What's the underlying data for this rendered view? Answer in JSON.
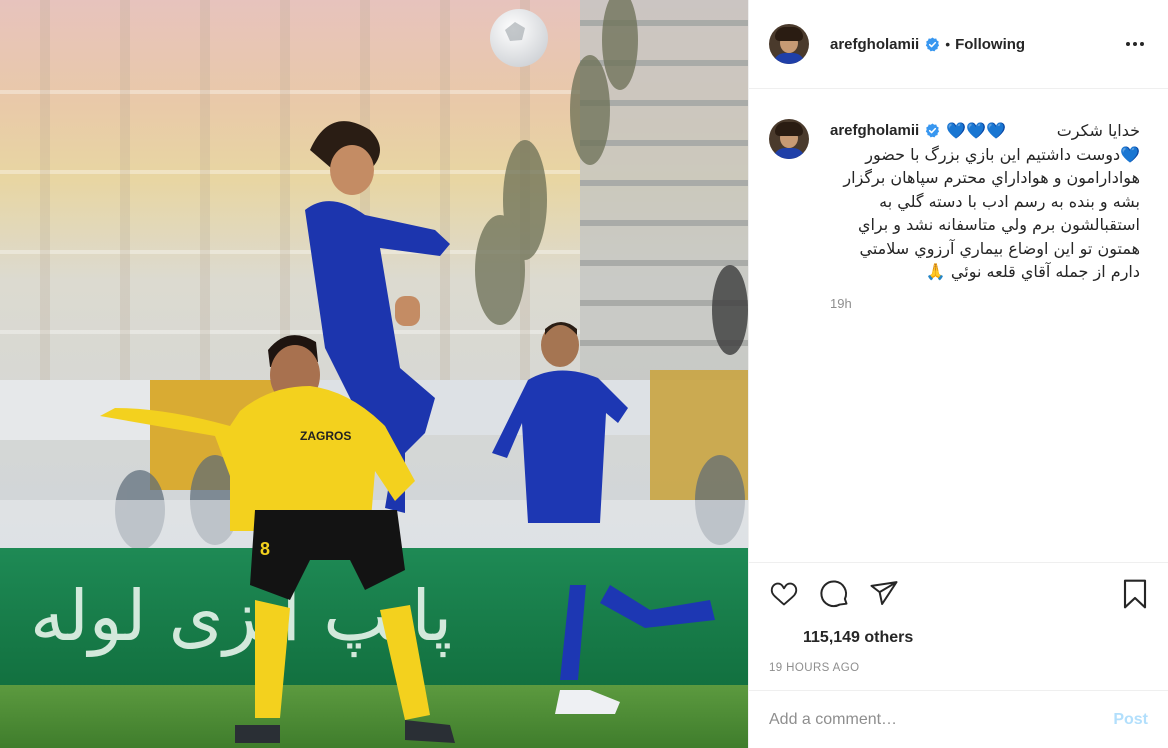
{
  "header": {
    "username": "arefgholamii",
    "separator": "•",
    "follow_status": "Following"
  },
  "caption": {
    "username": "arefgholamii",
    "first_line": "خدايا شكرت",
    "hearts": "💙💙💙",
    "body": "💙دوست داشتيم اين بازي بزرگ با حضور هوادارامون و هواداراي محترم سپاهان برگزار بشه و بنده به رسم ادب با دسته گلي به استقبالشون برم ولي متاسفانه نشد و براي همتون تو اين اوضاع بيماري آرزوي سلامتي دارم از جمله آقاي قلعه نوئي 🙏",
    "time": "19h"
  },
  "likes": {
    "text": "115,149 others"
  },
  "timestamp": "19 HOURS AGO",
  "comment_box": {
    "placeholder": "Add a comment…",
    "post_label": "Post"
  },
  "media": {
    "billboard_text": "پایپ ایزی لوله",
    "jersey_number": "8",
    "sponsor_text": "ZAGROS"
  },
  "colors": {
    "link_blue": "#0095f6",
    "post_disabled": "#b2dffc",
    "muted": "#8e8e8e",
    "verified": "#3897f0"
  }
}
